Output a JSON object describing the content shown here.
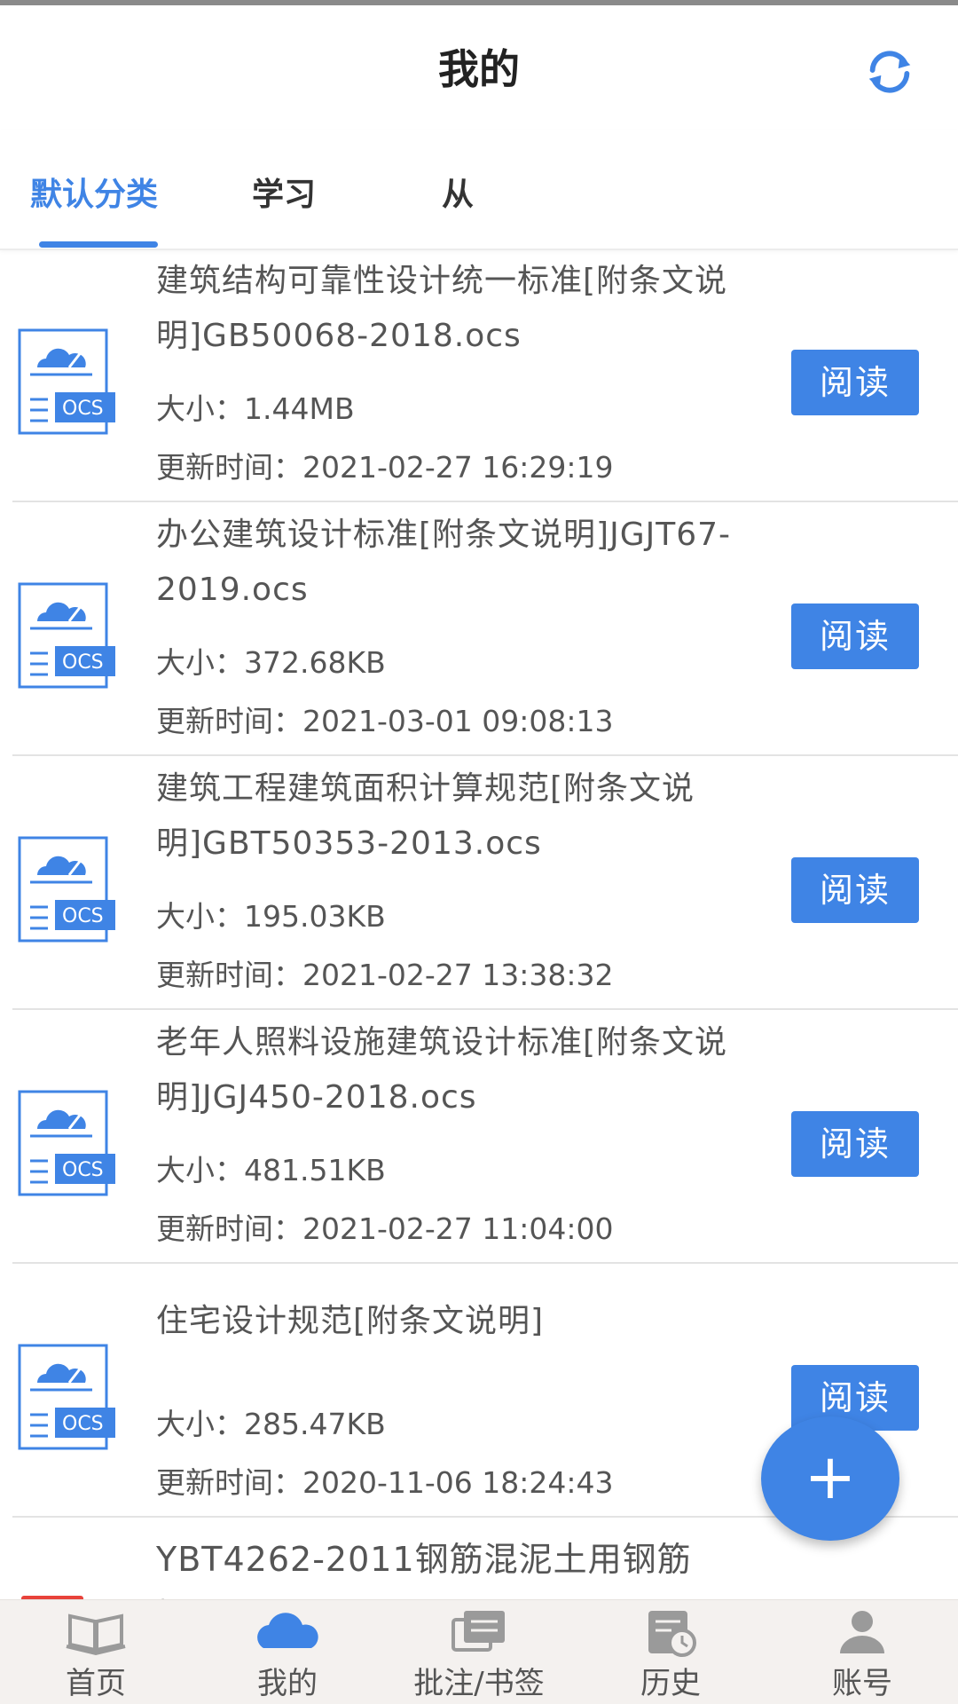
{
  "header": {
    "title": "我的",
    "refresh_icon": "refresh-icon"
  },
  "tabs": [
    {
      "label": "默认分类",
      "active": true
    },
    {
      "label": "学习",
      "active": false
    },
    {
      "label": "从",
      "active": false
    }
  ],
  "files": [
    {
      "name": "建筑结构可靠性设计统一标准[附条文说明]GB50068-2018.ocs",
      "size": "大小：1.44MB",
      "updated": "更新时间：2021-02-27 16:29:19",
      "file_type": "OCS",
      "action": "阅读"
    },
    {
      "name": "办公建筑设计标准[附条文说明]JGJT67-2019.ocs",
      "size": "大小：372.68KB",
      "updated": "更新时间：2021-03-01 09:08:13",
      "file_type": "OCS",
      "action": "阅读"
    },
    {
      "name": "建筑工程建筑面积计算规范[附条文说明]GBT50353-2013.ocs",
      "size": "大小：195.03KB",
      "updated": "更新时间：2021-02-27 13:38:32",
      "file_type": "OCS",
      "action": "阅读"
    },
    {
      "name": "老年人照料设施建筑设计标准[附条文说明]JGJ450-2018.ocs",
      "size": "大小：481.51KB",
      "updated": "更新时间：2021-02-27 11:04:00",
      "file_type": "OCS",
      "action": "阅读"
    },
    {
      "name": "住宅设计规范[附条文说明]",
      "size": "大小：285.47KB",
      "updated": "更新时间：2020-11-06 18:24:43",
      "file_type": "OCS",
      "action": "阅读"
    }
  ],
  "partial_file": {
    "name_line1": "YBT4262-2011钢筋混泥土用钢筋",
    "name_line2": "桁架.pdf"
  },
  "fab_label": "+",
  "bottom_nav": [
    {
      "label": "首页",
      "icon": "book-icon",
      "active": false
    },
    {
      "label": "我的",
      "icon": "cloud-icon",
      "active": true
    },
    {
      "label": "批注/书签",
      "icon": "notes-icon",
      "active": false
    },
    {
      "label": "历史",
      "icon": "history-icon",
      "active": false
    },
    {
      "label": "账号",
      "icon": "user-icon",
      "active": false
    }
  ],
  "colors": {
    "accent": "#3f84e5",
    "text": "#555555",
    "nav_bg": "#f4f1ef"
  }
}
